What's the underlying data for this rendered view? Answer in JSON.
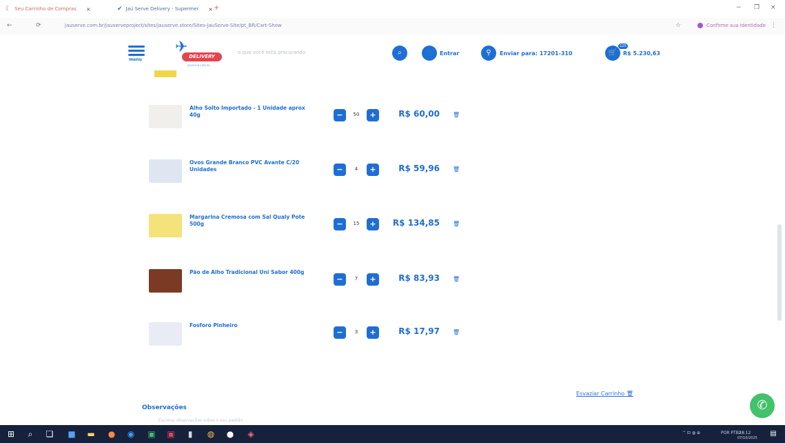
{
  "browser": {
    "tabs": [
      {
        "label": "Seu Carrinho de Compras",
        "close": "×"
      },
      {
        "label": "Jaú Serve Delivery - Supermer",
        "close": "×"
      }
    ],
    "new_tab": "+",
    "window": {
      "minimize": "−",
      "maximize": "❐",
      "close": "×"
    },
    "nav": {
      "back": "←",
      "reload": "⟳"
    },
    "url": "jauserve.com.br/jauserveproject/sites/jauserve.store/Sites-JauServe-Site/pt_BR/Cart-Show",
    "star": "☆",
    "profile_label": "Confirme sua identidade",
    "menu": "⋮"
  },
  "header": {
    "menu_label": "menu",
    "logo_text": "DELIVERY",
    "logo_sub": "jauserve.com.br",
    "search_placeholder": "o que você está procurando",
    "login_label": "Entrar",
    "ship_label": "Enviar para: 17201-310",
    "cart_count": "125",
    "cart_total": "R$ 5.230,63"
  },
  "items": [
    {
      "name": "Alho Solto Importado - 1 Unidade aprox 40g",
      "qty": "50",
      "price": "R$ 60,00",
      "thumb_color": "#f1efec"
    },
    {
      "name": "Ovos Grande Branco PVC Avante C/20 Unidades",
      "qty": "4",
      "price": "R$ 59,96",
      "thumb_color": "#dfe6f2"
    },
    {
      "name": "Margarina Cremosa com Sal Qualy Pote 500g",
      "qty": "15",
      "price": "R$ 134,85",
      "thumb_color": "#f4e27a"
    },
    {
      "name": "Pão de Alho Tradicional Uni Sabor 400g",
      "qty": "7",
      "price": "R$ 83,93",
      "thumb_color": "#7a3a24"
    },
    {
      "name": "Fosforo Pinheiro",
      "qty": "3",
      "price": "R$ 17,97",
      "thumb_color": "#e9ecf4"
    }
  ],
  "controls": {
    "minus": "−",
    "plus": "+",
    "trash": "🗑"
  },
  "clear_cart": "Esvaziar Carrinho",
  "observations": {
    "title": "Observações",
    "hint": "Escreva observações sobre o seu pedido"
  },
  "taskbar": {
    "lang": "POR PTB2",
    "time": "18:12",
    "date": "07/10/2025"
  }
}
